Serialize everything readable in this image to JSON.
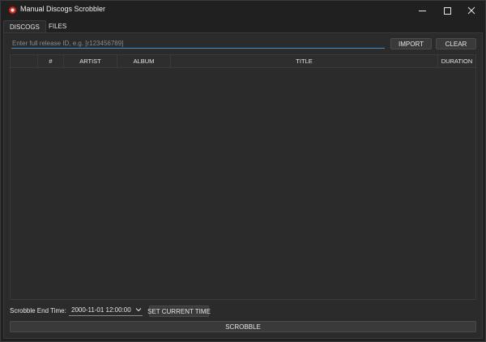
{
  "window": {
    "title": "Manual Discogs Scrobbler",
    "icon": "app-record-icon"
  },
  "tabs": [
    {
      "label": "DISCOGS",
      "active": true
    },
    {
      "label": "FILES",
      "active": false
    }
  ],
  "discogs": {
    "release_input": {
      "value": "",
      "placeholder": "Enter full release ID, e.g. [r123456789]"
    },
    "import_label": "IMPORT",
    "clear_label": "CLEAR",
    "table": {
      "columns": [
        "",
        "#",
        "ARTIST",
        "ALBUM",
        "TITLE",
        "DURATION"
      ],
      "rows": []
    },
    "scrobble_end_time_label": "Scrobble End Time:",
    "scrobble_end_time_value": "2000-11-01 12:00:00",
    "set_current_time_label": "SET CURRENT TIME",
    "scrobble_label": "SCROBBLE"
  },
  "colors": {
    "background": "#202020",
    "panel": "#2b2b2b",
    "accent": "#3d8fd1",
    "text": "#e6e6e6"
  }
}
